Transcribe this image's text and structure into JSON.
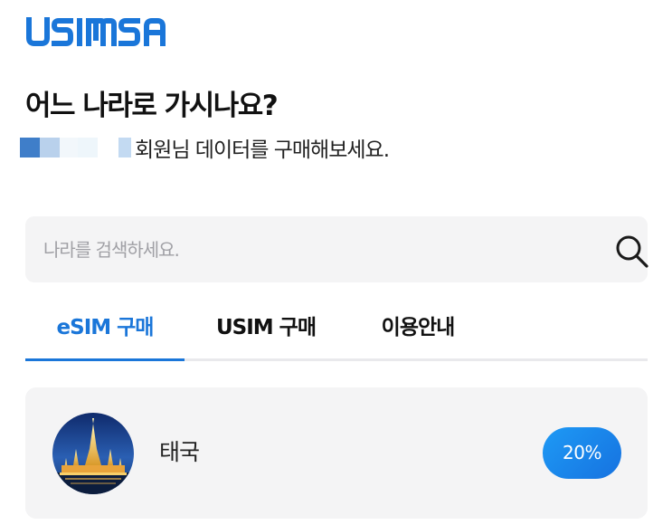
{
  "brand": {
    "logo": "USIMSA",
    "color": "#1a76d9"
  },
  "heading": {
    "title": "어느 나라로 가시나요?"
  },
  "greeting": {
    "text": "회원님 데이터를 구매해보세요."
  },
  "search": {
    "placeholder": "나라를 검색하세요.",
    "value": "",
    "icon": "search-icon"
  },
  "tabs": [
    {
      "label": "eSIM 구매",
      "active": true
    },
    {
      "label": "USIM 구매",
      "active": false
    },
    {
      "label": "이용안내",
      "active": false
    }
  ],
  "products": [
    {
      "country": "태국",
      "discount": "20%",
      "image": "thailand-temple-image"
    }
  ]
}
